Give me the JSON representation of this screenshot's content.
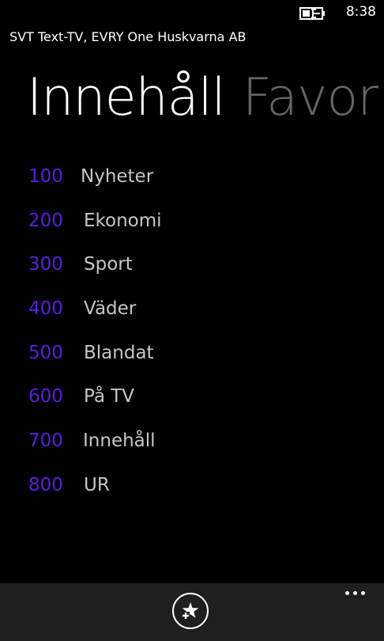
{
  "status_bar": {
    "time": "8:38",
    "battery_icon": "battery-charging-icon"
  },
  "app": {
    "title": "SVT Text-TV, EVRY One Huskvarna AB"
  },
  "pivot": {
    "active_label": "Innehåll",
    "inactive_label": "Favor"
  },
  "categories": [
    {
      "page": "100",
      "label": "Nyheter"
    },
    {
      "page": "200",
      "label": "Ekonomi"
    },
    {
      "page": "300",
      "label": "Sport"
    },
    {
      "page": "400",
      "label": "Väder"
    },
    {
      "page": "500",
      "label": "Blandat"
    },
    {
      "page": "600",
      "label": "På TV"
    },
    {
      "page": "700",
      "label": "Innehåll"
    },
    {
      "page": "800",
      "label": "UR"
    }
  ],
  "app_bar": {
    "add_favorite_icon": "add-favorite-icon",
    "more_icon": "more-dots-icon"
  },
  "colors": {
    "accent": "#5a1ee0",
    "background": "#000000",
    "app_bar": "#1f1f1f",
    "label_text": "#c6c6c6",
    "inactive_pivot": "#666666"
  }
}
